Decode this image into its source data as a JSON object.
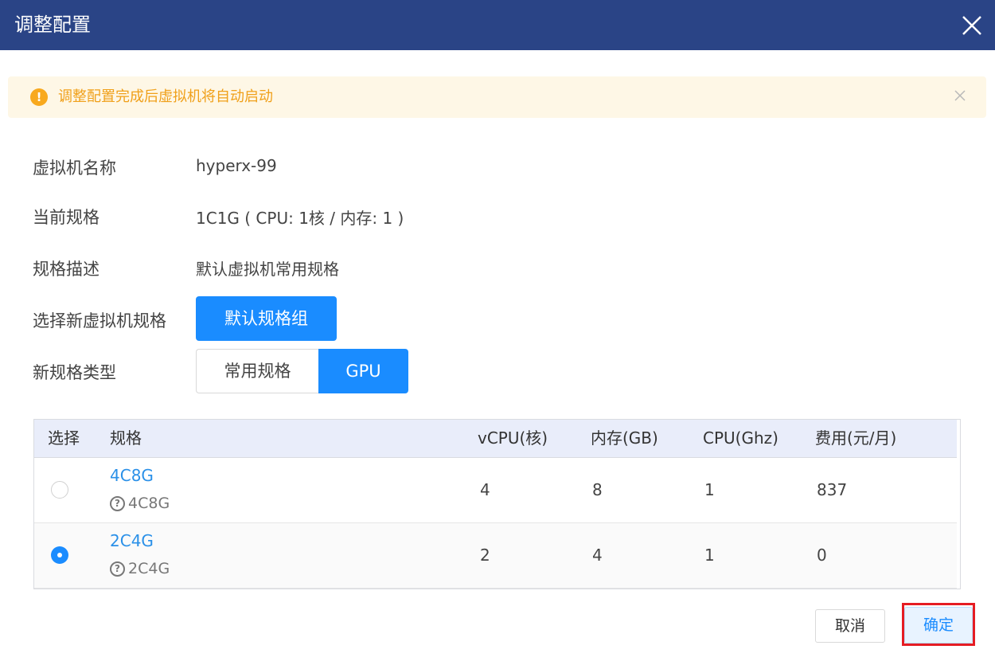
{
  "dialog": {
    "title": "调整配置",
    "close_icon": "close-icon"
  },
  "alert": {
    "icon": "warning-icon",
    "message": "调整配置完成后虚拟机将自动启动"
  },
  "info": {
    "name_label": "虚拟机名称",
    "name_value": "hyperx-99",
    "spec_label": "当前规格",
    "spec_value": "1C1G ( CPU: 1核 / 内存: 1 )",
    "desc_label": "规格描述",
    "desc_value": "默认虚拟机常用规格",
    "select_label": "选择新虚拟机规格",
    "select_button": "默认规格组",
    "type_label": "新规格类型",
    "type_options": [
      "常用规格",
      "GPU"
    ],
    "type_selected": "GPU"
  },
  "table": {
    "headers": [
      "选择",
      "规格",
      "vCPU(核)",
      "内存(GB)",
      "CPU(Ghz)",
      "费用(元/月)"
    ],
    "rows": [
      {
        "checked": false,
        "name": "4C8G",
        "sub": "4C8G",
        "vcpu": "4",
        "mem": "8",
        "cpu": "1",
        "cost": "837"
      },
      {
        "checked": true,
        "name": "2C4G",
        "sub": "2C4G",
        "vcpu": "2",
        "mem": "4",
        "cpu": "1",
        "cost": "0"
      }
    ]
  },
  "footer": {
    "cancel": "取消",
    "confirm": "确定"
  },
  "colors": {
    "header_bg": "#2a4486",
    "primary": "#1a8cff",
    "warning": "#f0a01a",
    "highlight": "#e51c23"
  }
}
